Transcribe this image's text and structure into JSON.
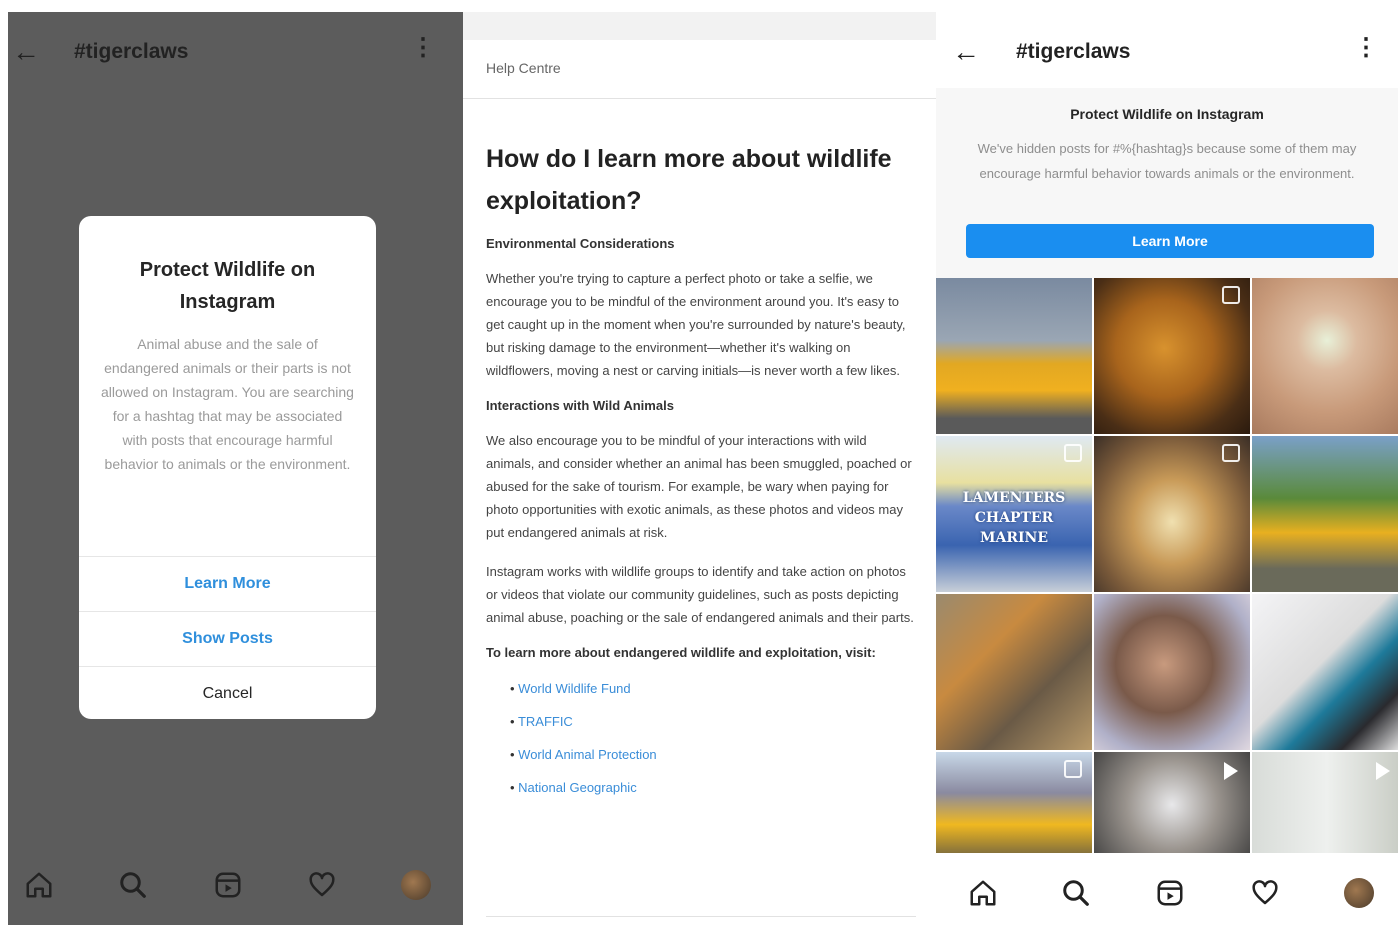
{
  "panel1": {
    "header": {
      "back_icon": "arrow-left-icon",
      "title": "#tigerclaws",
      "more_icon": "more-vertical-icon"
    },
    "dialog": {
      "title": "Protect Wildlife on Instagram",
      "body": "Animal abuse and the sale of endangered animals or their parts is not allowed on Instagram. You are searching for a hashtag that may be associated with posts that encourage harmful behavior to animals or the environment.",
      "learn_more": "Learn More",
      "show_posts": "Show Posts",
      "cancel": "Cancel"
    },
    "nav": [
      "home-icon",
      "search-icon",
      "reels-icon",
      "heart-icon",
      "profile-avatar"
    ]
  },
  "panel2": {
    "breadcrumb": "Help Centre",
    "title": "How do I learn more about wildlife exploitation?",
    "section1_heading": "Environmental Considerations",
    "section1_body": "Whether you're trying to capture a perfect photo or take a selfie, we encourage you to be mindful of the environment around you. It's easy to get caught up in the moment when you're surrounded by nature's beauty, but risking damage to the environment—whether it's walking on wildflowers, moving a nest or carving initials—is never worth a few likes.",
    "section2_heading": "Interactions with Wild Animals",
    "section2_body": "We also encourage you to be mindful of your interactions with wild animals, and consider whether an animal has been smuggled, poached or abused for the sake of tourism. For example, be wary when paying for photo opportunities with exotic animals, as these photos and videos may put endangered animals at risk.",
    "section3_body": "Instagram works with wildlife groups to identify and take action on photos or videos that violate our community guidelines, such as posts depicting animal abuse, poaching or the sale of endangered animals and their parts.",
    "links_intro": "To learn more about endangered wildlife and exploitation, visit:",
    "links": [
      "World Wildlife Fund",
      "TRAFFIC",
      "World Animal Protection",
      "National Geographic"
    ]
  },
  "panel3": {
    "header": {
      "back_icon": "arrow-left-icon",
      "title": "#tigerclaws",
      "more_icon": "more-vertical-icon"
    },
    "banner": {
      "title": "Protect Wildlife on Instagram",
      "body": "We've hidden posts for #%{hashtag}s because some of them may encourage harmful behavior towards animals or the environment.",
      "button": "Learn More"
    },
    "grid_overlay_text": "LAMENTERS CHAPTER MARINE",
    "nav": [
      "home-icon",
      "search-icon",
      "reels-icon",
      "heart-icon",
      "profile-avatar"
    ]
  },
  "colors": {
    "overlay": "#5c5c5c",
    "link_blue": "#2f8fdc",
    "button_blue": "#1a8ef0"
  }
}
